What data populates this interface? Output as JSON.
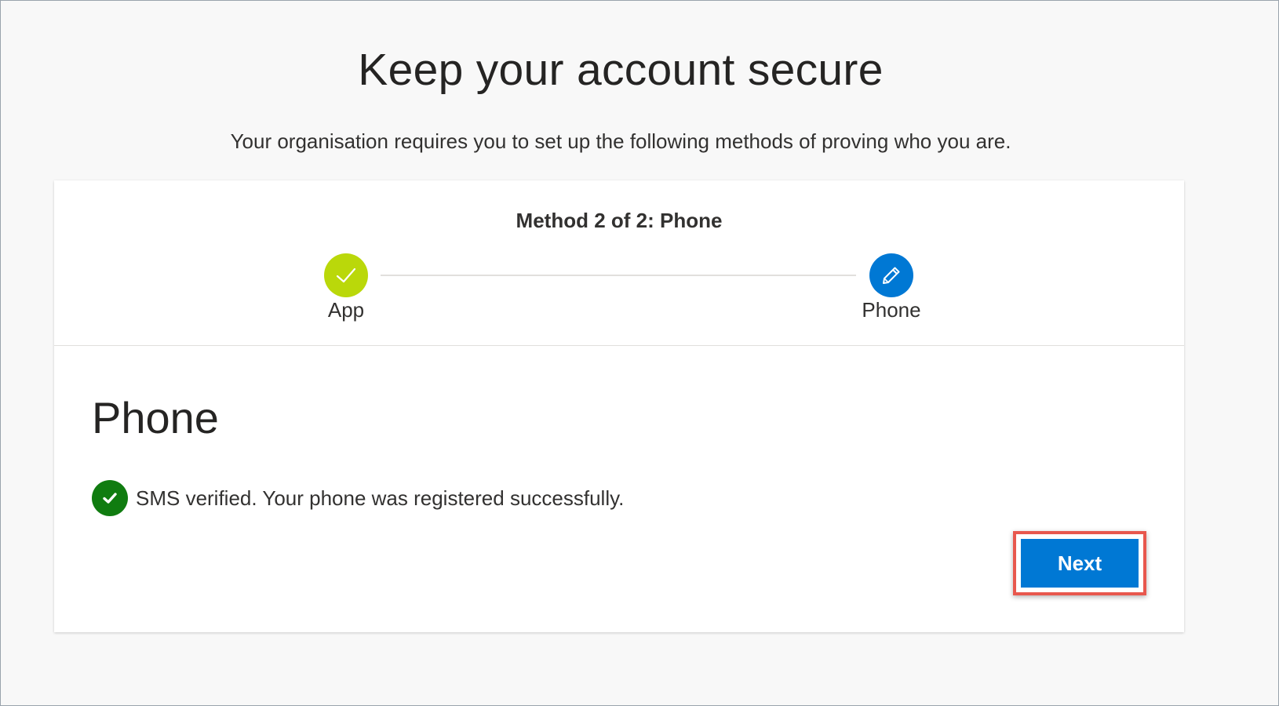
{
  "header": {
    "title": "Keep your account secure",
    "subtitle": "Your organisation requires you to set up the following methods of proving who you are."
  },
  "wizard": {
    "method_title": "Method 2 of 2: Phone",
    "steps": [
      {
        "label": "App",
        "status": "completed",
        "icon": "checkmark-icon"
      },
      {
        "label": "Phone",
        "status": "current",
        "icon": "pencil-icon"
      }
    ]
  },
  "section": {
    "title": "Phone",
    "success_message": "SMS verified. Your phone was registered successfully.",
    "success_icon": "check-circle-icon"
  },
  "actions": {
    "next_label": "Next"
  },
  "colors": {
    "completed_step": "#bad80a",
    "current_step": "#0078d4",
    "success": "#107c10",
    "primary_button": "#0078d4",
    "highlight": "#e8584e"
  }
}
